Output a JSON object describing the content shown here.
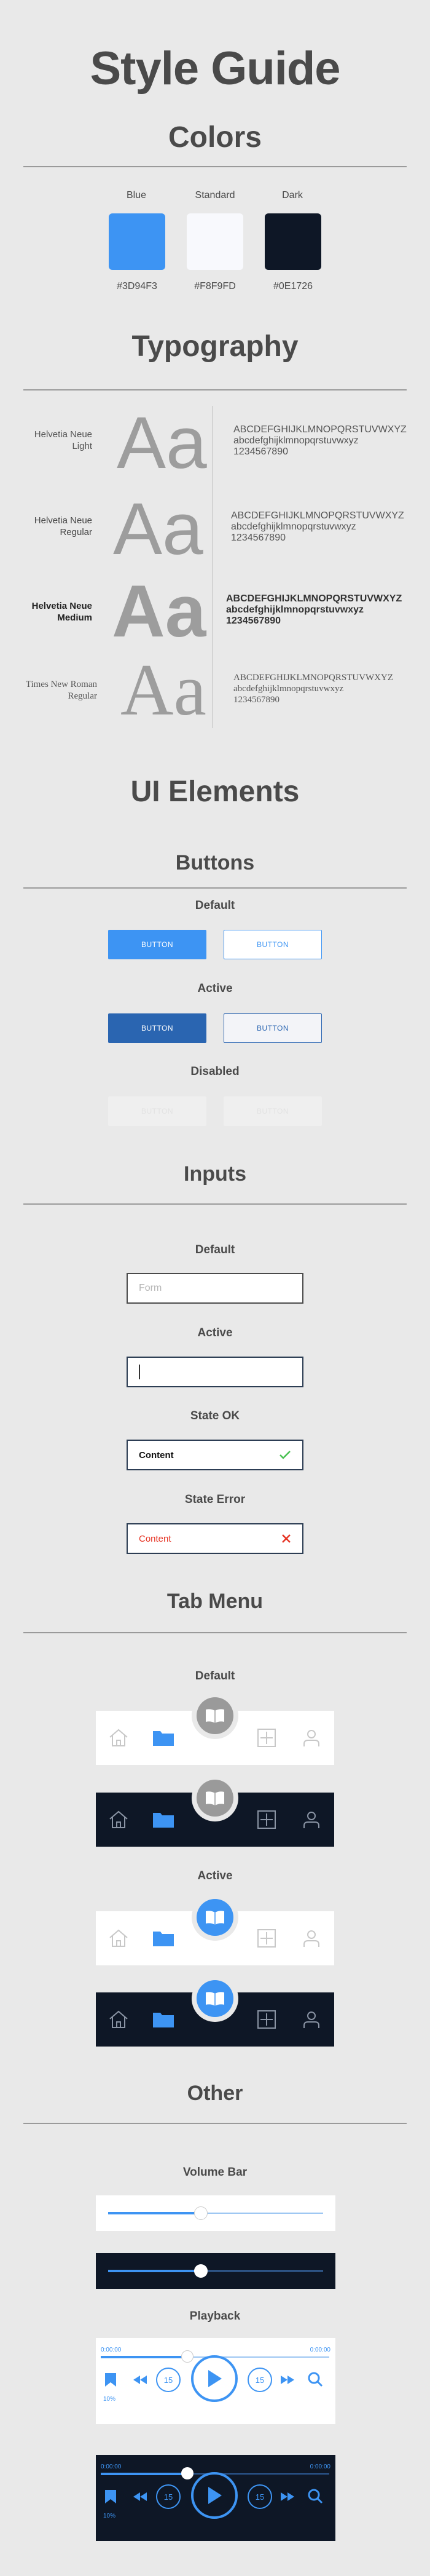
{
  "title": "Style Guide",
  "colors": {
    "heading": "Colors",
    "swatches": [
      {
        "name": "Blue",
        "hex": "#3D94F3",
        "label": "#3D94F3"
      },
      {
        "name": "Standard",
        "hex": "#F8F9FD",
        "label": "#F8F9FD"
      },
      {
        "name": "Dark",
        "hex": "#0E1726",
        "label": "#0E1726"
      }
    ]
  },
  "typography": {
    "heading": "Typography",
    "fonts": [
      {
        "name": "Helvetia Neue\nLight",
        "sample": "Aa",
        "chars": "ABCDEFGHIJKLMNOPQRSTUVWXYZ\nabcdefghijklmnopqrstuvwxyz\n1234567890"
      },
      {
        "name": "Helvetia Neue\nRegular",
        "sample": "Aa",
        "chars": "ABCDEFGHIJKLMNOPQRSTUVWXYZ\nabcdefghijklmnopqrstuvwxyz\n1234567890"
      },
      {
        "name": "Helvetia Neue\nMedium",
        "sample": "Aa",
        "chars": "ABCDEFGHIJKLMNOPQRSTUVWXYZ\nabcdefghijklmnopqrstuvwxyz\n1234567890"
      },
      {
        "name": "Times New Roman\nRegular",
        "sample": "Aa",
        "chars": "ABCDEFGHIJKLMNOPQRSTUVWXYZ\nabcdefghijklmnopqrstuvwxyz\n1234567890"
      }
    ]
  },
  "ui_elements": {
    "heading": "UI Elements",
    "buttons": {
      "heading": "Buttons",
      "default_label": "Default",
      "active_label": "Active",
      "disabled_label": "Disabled",
      "button_text": "BUTTON"
    },
    "inputs": {
      "heading": "Inputs",
      "default_label": "Default",
      "default_placeholder": "Form",
      "active_label": "Active",
      "ok_label": "State OK",
      "ok_value": "Content",
      "error_label": "State Error",
      "error_value": "Content"
    },
    "tab_menu": {
      "heading": "Tab Menu",
      "default_label": "Default",
      "active_label": "Active",
      "icons": [
        "home-icon",
        "folder-icon",
        "book-icon",
        "plus-box-icon",
        "user-icon"
      ]
    },
    "other": {
      "heading": "Other",
      "volume_label": "Volume Bar",
      "volume_level": 0.43,
      "playback_label": "Playback",
      "time_start": "0:00:00",
      "time_end": "0:00:00",
      "playback_position": 0.38,
      "skip_back": "15",
      "skip_forward": "15",
      "speed": "10%"
    }
  }
}
